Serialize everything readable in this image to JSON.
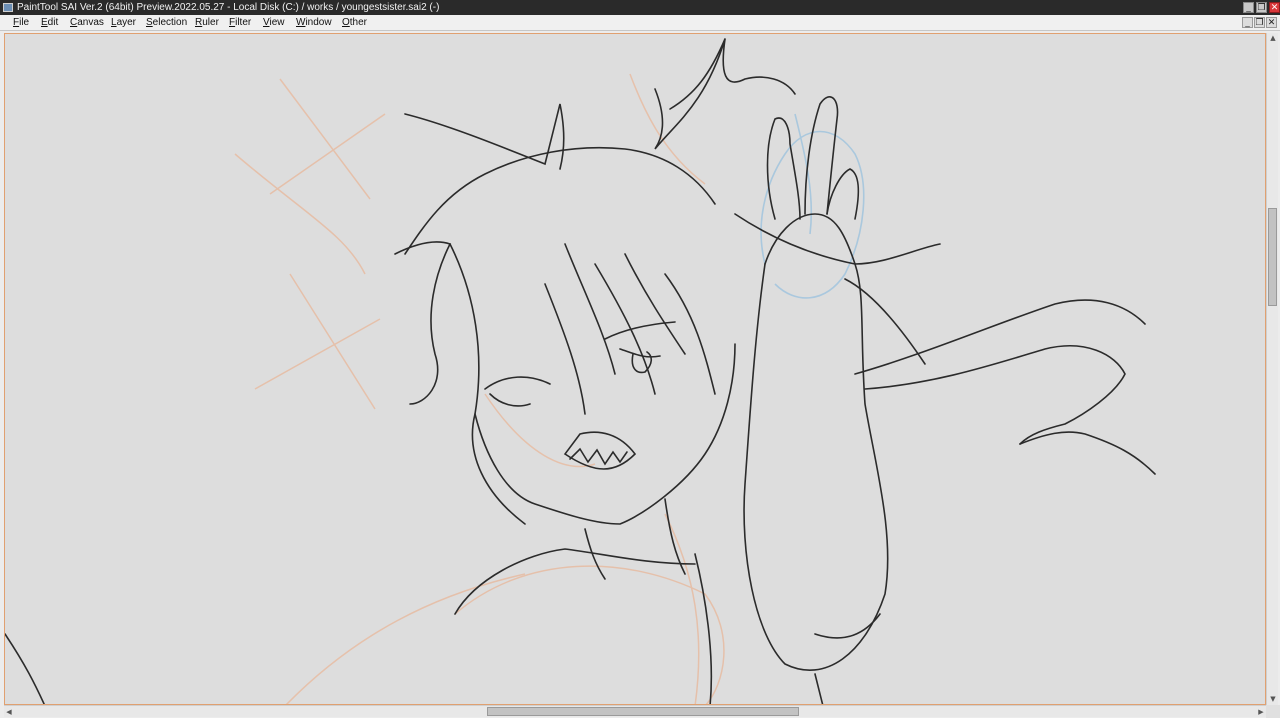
{
  "window": {
    "title": "PaintTool SAI Ver.2 (64bit) Preview.2022.05.27 - Local Disk (C:) / works / youngestsister.sai2 (-)",
    "buttons": {
      "minimize": "_",
      "restore": "❐",
      "close": "✕"
    }
  },
  "menubar": {
    "items": [
      {
        "label": "File",
        "u": "F",
        "rest": "ile"
      },
      {
        "label": "Edit",
        "u": "E",
        "rest": "dit"
      },
      {
        "label": "Canvas",
        "u": "C",
        "rest": "anvas"
      },
      {
        "label": "Layer",
        "u": "L",
        "rest": "ayer"
      },
      {
        "label": "Selection",
        "u": "S",
        "rest": "election"
      },
      {
        "label": "Ruler",
        "u": "R",
        "rest": "uler"
      },
      {
        "label": "Filter",
        "u": "F",
        "rest": "ilter"
      },
      {
        "label": "View",
        "u": "V",
        "rest": "iew"
      },
      {
        "label": "Window",
        "u": "W",
        "rest": "indow"
      },
      {
        "label": "Other",
        "u": "O",
        "rest": "ther"
      }
    ],
    "doc_buttons": {
      "minimize": "_",
      "restore": "❐",
      "close": "✕"
    }
  },
  "canvas": {
    "background": "#dddddd",
    "sketch_colors": {
      "lineart": "#2b2b2b",
      "rough": "#e8b79a",
      "hand": "#9ec3de"
    }
  },
  "scroll": {
    "up": "▲",
    "down": "▼",
    "left": "◀",
    "right": "▶"
  }
}
